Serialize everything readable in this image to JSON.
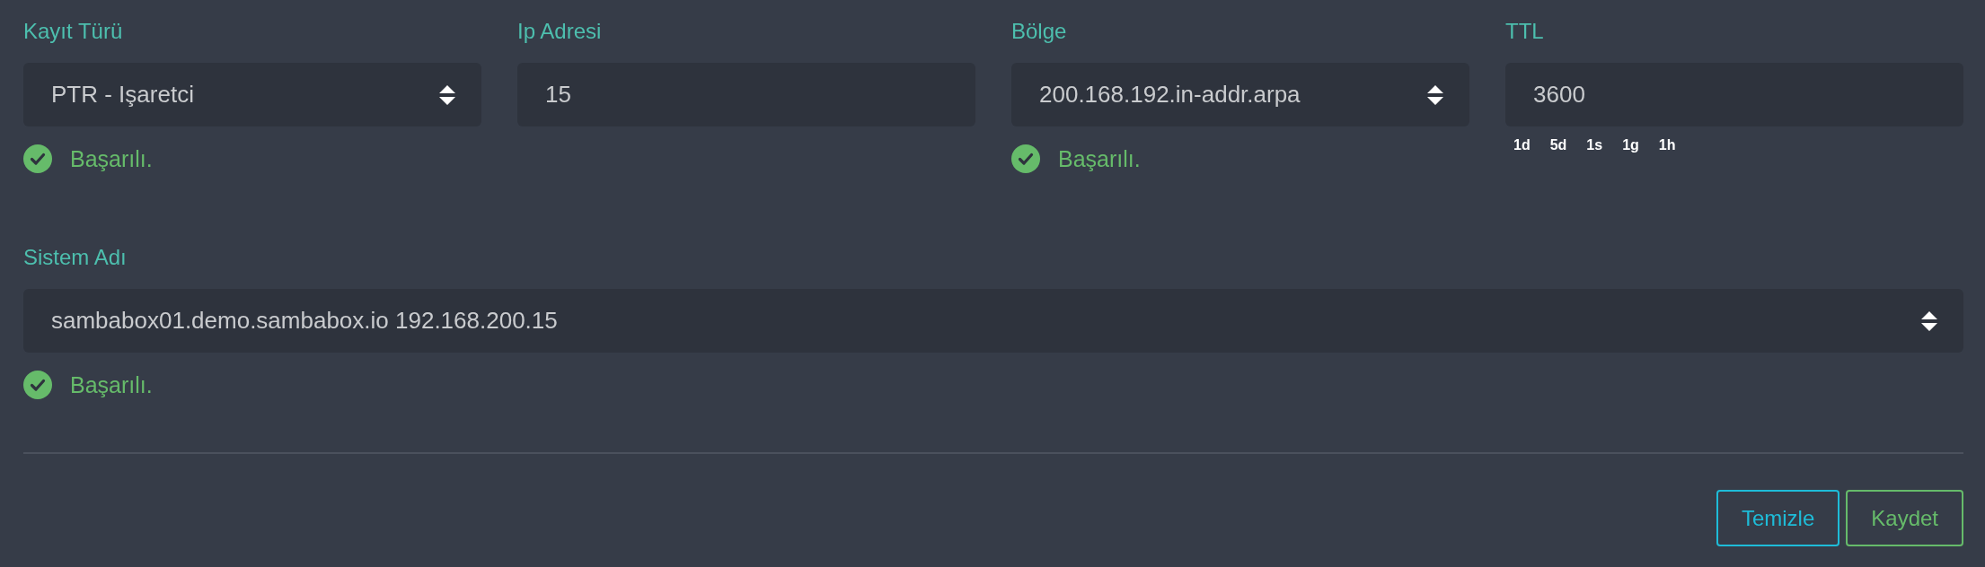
{
  "rows": [
    {
      "fields": [
        {
          "label": "Kayıt Türü",
          "kind": "select",
          "value": "PTR - Işaretci",
          "status": {
            "kind": "success",
            "text": "Başarılı."
          }
        },
        {
          "label": "Ip Adresi",
          "kind": "input",
          "value": "15"
        },
        {
          "label": "Bölge",
          "kind": "select",
          "value": "200.168.192.in-addr.arpa",
          "status": {
            "kind": "success",
            "text": "Başarılı."
          }
        },
        {
          "label": "TTL",
          "kind": "input",
          "value": "3600",
          "shortcuts": [
            "1d",
            "5d",
            "1s",
            "1g",
            "1h"
          ]
        }
      ]
    },
    {
      "fields": [
        {
          "label": "Sistem Adı",
          "kind": "select",
          "value": "sambabox01.demo.sambabox.io 192.168.200.15",
          "status": {
            "kind": "success",
            "text": "Başarılı."
          }
        }
      ]
    }
  ],
  "buttons": [
    {
      "label": "Temizle",
      "kind": "clear"
    },
    {
      "label": "Kaydet",
      "kind": "save"
    }
  ]
}
